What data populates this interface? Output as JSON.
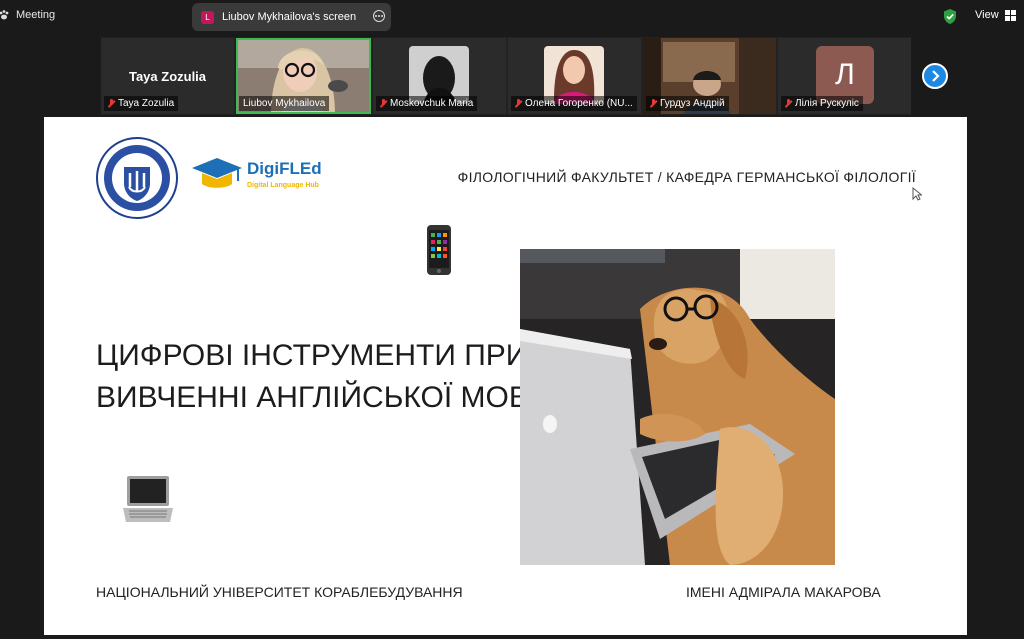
{
  "app": {
    "title": "Meeting"
  },
  "share": {
    "badge": "L",
    "label": "Liubov Mykhailova's screen"
  },
  "view": {
    "label": "View"
  },
  "colors": {
    "accent": "#1e88e5",
    "active_speaker": "#3fb950",
    "muted": "#e53935"
  },
  "participants": [
    {
      "display": "Taya Zozulia",
      "name": "Taya Zozulia",
      "type": "name-card",
      "muted": true
    },
    {
      "name": "Liubov Mykhailova",
      "type": "video",
      "muted": false,
      "active": true
    },
    {
      "name": "Moskovchuk Maria",
      "type": "video",
      "muted": true
    },
    {
      "name": "Олена Гогоренко (NU...",
      "type": "video",
      "muted": true
    },
    {
      "name": "Гурдуз Андрій",
      "type": "video",
      "muted": true
    },
    {
      "name": "Лілія Рускуліс",
      "type": "avatar",
      "letter": "Л",
      "muted": true
    }
  ],
  "slide": {
    "header": "ФІЛОЛОГІЧНИЙ ФАКУЛЬТЕТ / КАФЕДРА ГЕРМАНСЬКОЇ ФІЛОЛОГІЇ",
    "title_line1": "ЦИФРОВІ ІНСТРУМЕНТИ ПРИ",
    "title_line2": "ВИВЧЕННІ АНГЛІЙСЬКОЇ МОВИ",
    "footer_left": "НАЦІОНАЛЬНИЙ УНІВЕРСИТЕТ КОРАБЛЕБУДУВАННЯ",
    "footer_right": "ІМЕНІ АДМІРАЛА МАКАРОВА",
    "logo": {
      "title": "DigiFLEd",
      "subtitle": "Digital Language Hub"
    },
    "icons": [
      "university-seal-icon",
      "mobile-phone-icon",
      "laptop-icon",
      "dog-with-laptop-photo"
    ]
  }
}
